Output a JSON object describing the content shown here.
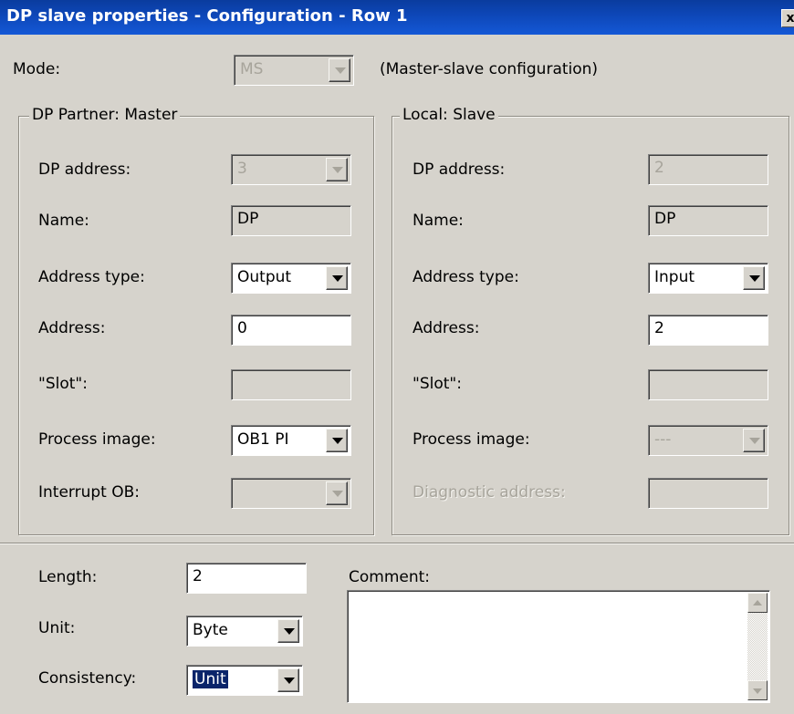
{
  "window": {
    "title": "DP slave properties - Configuration - Row 1",
    "close_symbol": "x"
  },
  "mode": {
    "label": "Mode:",
    "value": "MS",
    "description": "(Master-slave configuration)"
  },
  "master": {
    "group_title": "DP Partner: Master",
    "dp_address_label": "DP address:",
    "dp_address_value": "3",
    "name_label": "Name:",
    "name_value": "DP",
    "address_type_label": "Address type:",
    "address_type_value": "Output",
    "address_label": "Address:",
    "address_value": "0",
    "slot_label": "\"Slot\":",
    "slot_value": "",
    "process_image_label": "Process image:",
    "process_image_value": "OB1 PI",
    "interrupt_ob_label": "Interrupt OB:",
    "interrupt_ob_value": ""
  },
  "slave": {
    "group_title": "Local: Slave",
    "dp_address_label": "DP address:",
    "dp_address_value": "2",
    "name_label": "Name:",
    "name_value": "DP",
    "address_type_label": "Address type:",
    "address_type_value": "Input",
    "address_label": "Address:",
    "address_value": "2",
    "slot_label": "\"Slot\":",
    "slot_value": "",
    "process_image_label": "Process image:",
    "process_image_value": "---",
    "diagnostic_address_label": "Diagnostic address:",
    "diagnostic_address_value": ""
  },
  "bottom": {
    "length_label": "Length:",
    "length_value": "2",
    "unit_label": "Unit:",
    "unit_value": "Byte",
    "consistency_label": "Consistency:",
    "consistency_value": "Unit",
    "comment_label": "Comment:",
    "comment_value": ""
  },
  "colors": {
    "titlebar": "#0d46b6",
    "dialog_bg": "#d6d3cc",
    "selection": "#0a246a"
  }
}
